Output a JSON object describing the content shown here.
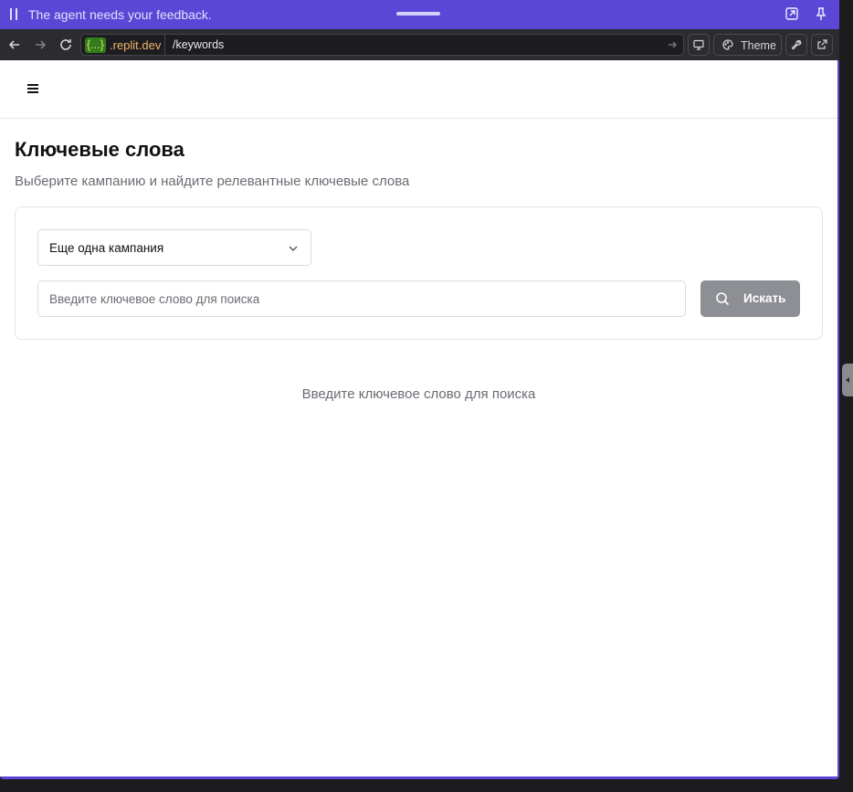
{
  "feedback_bar": {
    "message": "The agent needs your feedback."
  },
  "browser": {
    "domain_badge": "{...}",
    "domain_rest": ".replit.dev",
    "path": "/keywords",
    "theme_label": "Theme"
  },
  "page": {
    "title": "Ключевые слова",
    "subtitle": "Выберите кампанию и найдите релевантные ключевые слова"
  },
  "campaign_select": {
    "selected": "Еще одна кампания"
  },
  "search": {
    "placeholder": "Введите ключевое слово для поиска",
    "value": "",
    "button_label": "Искать"
  },
  "empty_state": {
    "message": "Введите ключевое слово для поиска"
  },
  "colors": {
    "frame": "#5b47d6",
    "url_bar": "#2b2b30",
    "search_button": "#8d8f94",
    "domain_badge": "#2f7d1c"
  }
}
